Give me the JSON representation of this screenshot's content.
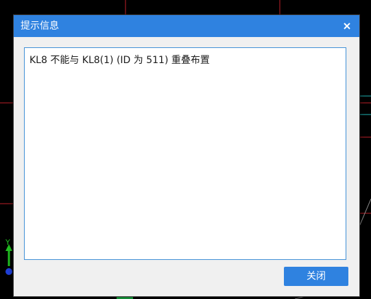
{
  "dialog": {
    "title": "提示信息",
    "close_icon": "close-icon",
    "message": "KL8 不能与 KL8(1) (ID 为 511) 重叠布置",
    "close_button_label": "关闭"
  },
  "cad_canvas": {
    "axis_label_y": "Y"
  },
  "colors": {
    "titlebar": "#2f82e0",
    "button": "#2f82e0",
    "dialog_bg": "#f0f0f0",
    "message_border": "#3f8fd6",
    "canvas_bg": "#000000"
  }
}
